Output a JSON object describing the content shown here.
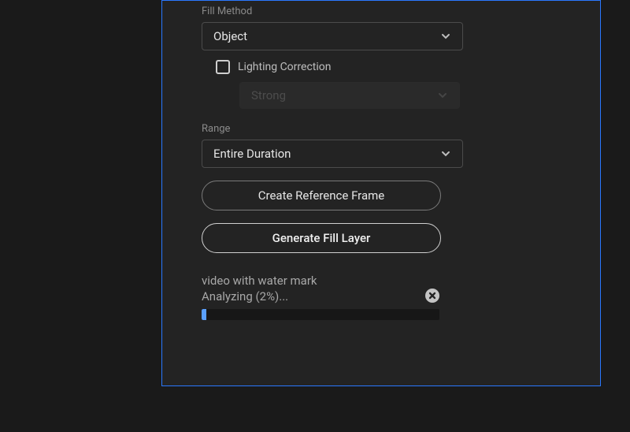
{
  "fill_method": {
    "label": "Fill Method",
    "selected": "Object"
  },
  "lighting_correction": {
    "label": "Lighting Correction",
    "checked": false,
    "strength": {
      "selected": "Strong",
      "disabled": true
    }
  },
  "range": {
    "label": "Range",
    "selected": "Entire Duration"
  },
  "buttons": {
    "create_reference": "Create Reference Frame",
    "generate_fill": "Generate Fill Layer"
  },
  "progress": {
    "asset_name": "video with water mark",
    "status_prefix": "Analyzing (",
    "percent": 2,
    "status_suffix": "%)..."
  }
}
